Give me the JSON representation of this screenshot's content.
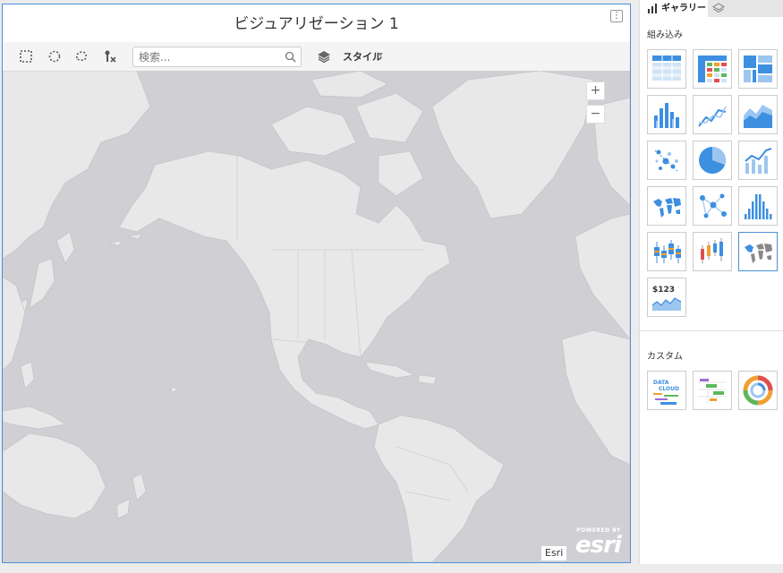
{
  "visualization": {
    "title": "ビジュアリゼーション 1",
    "more_icon": "⋮"
  },
  "toolbar": {
    "tools": [
      {
        "name": "rectangle-select-icon"
      },
      {
        "name": "circle-select-icon"
      },
      {
        "name": "lasso-select-icon"
      },
      {
        "name": "clear-selection-icon"
      }
    ],
    "search_placeholder": "検索...",
    "style_label": "スタイル"
  },
  "map": {
    "zoom_in_label": "+",
    "zoom_out_label": "−",
    "attribution": "Esri",
    "logo_powered": "POWERED BY",
    "logo_word": "esri",
    "colors": {
      "water": "#cfcfd4",
      "land": "#e8e8e8",
      "border": "#c8c8c8"
    }
  },
  "gallery": {
    "tab_gallery_label": "ギャラリー",
    "builtin_label": "組み込み",
    "custom_label": "カスタム",
    "builtin_tiles": [
      {
        "name": "table-icon"
      },
      {
        "name": "crosstab-icon"
      },
      {
        "name": "treemap-icon"
      },
      {
        "name": "bar-chart-icon"
      },
      {
        "name": "line-chart-icon"
      },
      {
        "name": "area-chart-icon"
      },
      {
        "name": "scatter-plot-icon"
      },
      {
        "name": "pie-chart-icon"
      },
      {
        "name": "combination-chart-icon"
      },
      {
        "name": "map-icon"
      },
      {
        "name": "network-icon"
      },
      {
        "name": "histogram-icon"
      },
      {
        "name": "box-plot-icon"
      },
      {
        "name": "candlestick-icon"
      },
      {
        "name": "map-selected-icon",
        "selected": true
      },
      {
        "name": "kpi-icon",
        "text": "$123"
      }
    ],
    "custom_tiles": [
      {
        "name": "data-cloud-icon",
        "text": [
          "DATA",
          "CLOUD"
        ]
      },
      {
        "name": "gantt-icon"
      },
      {
        "name": "sunburst-icon"
      }
    ],
    "accent": "#3d8fe0"
  }
}
